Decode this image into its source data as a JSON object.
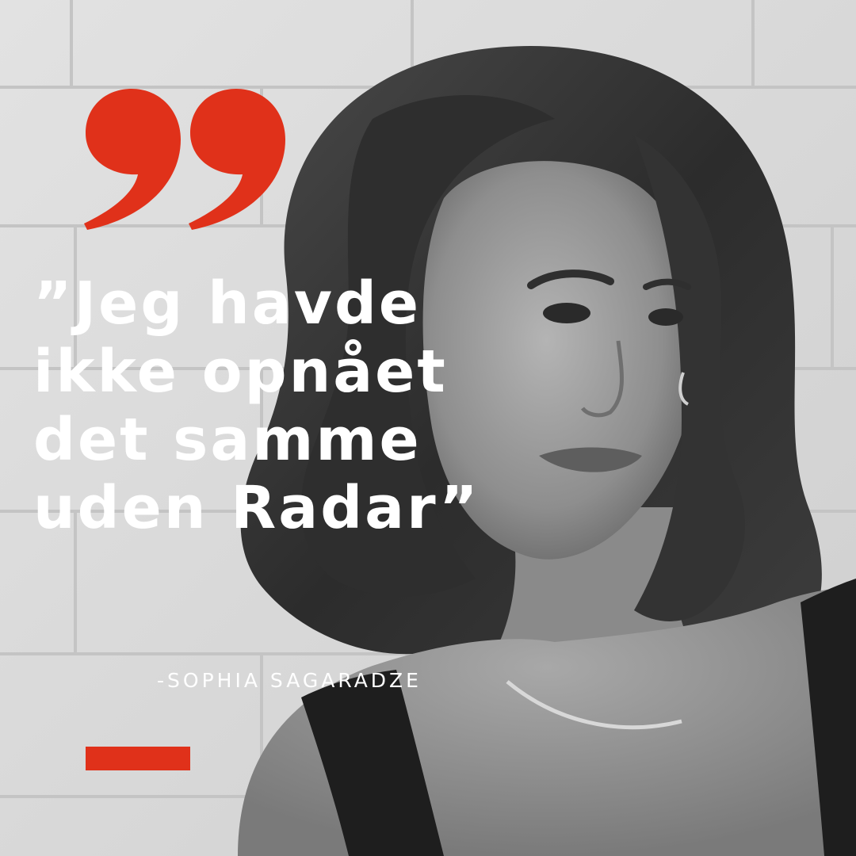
{
  "quote": {
    "lines": [
      "”Jeg havde",
      "ikke opnået",
      "det samme",
      "uden Radar”"
    ]
  },
  "attribution": "-SOPHIA SAGARADZE",
  "colors": {
    "accent": "#e0311a",
    "text": "#ffffff",
    "wall": "#dcdcdc",
    "hair": "#3a3a3a",
    "skin": "#8f8f8f"
  },
  "icons": {
    "quote_mark": "closing-double-quote-icon"
  }
}
